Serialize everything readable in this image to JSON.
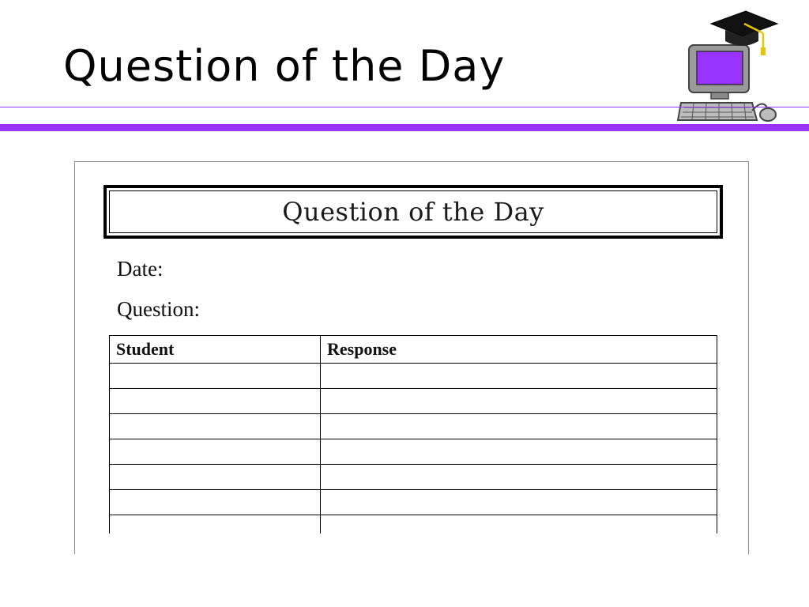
{
  "slide": {
    "title": "Question of the Day",
    "accent_color": "#9933ff",
    "logo_icon": "computer-graduation-cap-icon"
  },
  "document": {
    "header_title": "Question of the Day",
    "date_label": "Date:",
    "question_label": "Question:",
    "table": {
      "columns": [
        "Student",
        "Response"
      ],
      "rows": [
        [
          "",
          ""
        ],
        [
          "",
          ""
        ],
        [
          "",
          ""
        ],
        [
          "",
          ""
        ],
        [
          "",
          ""
        ],
        [
          "",
          ""
        ],
        [
          "",
          ""
        ]
      ]
    }
  }
}
